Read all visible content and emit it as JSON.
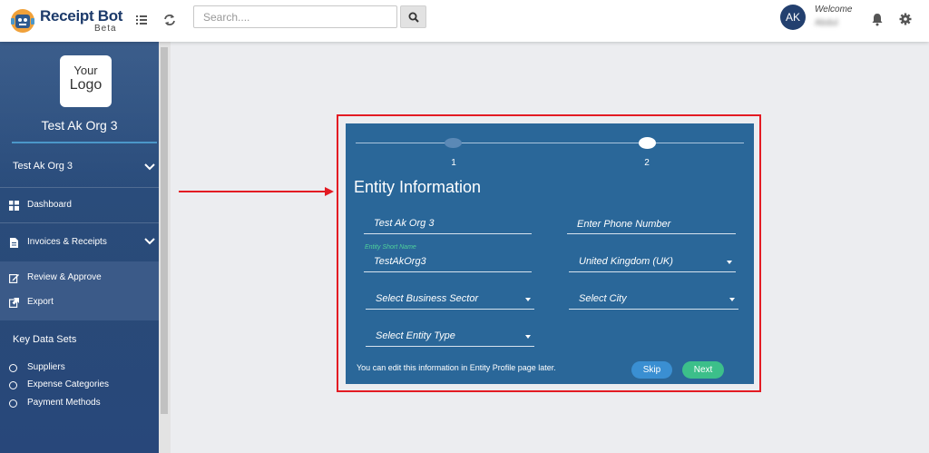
{
  "header": {
    "brand": "Receipt Bot",
    "brand_sub": "Beta",
    "search_placeholder": "Search....",
    "avatar_initials": "AK",
    "welcome_label": "Welcome",
    "user_name": "Abdul"
  },
  "sidebar": {
    "logo_line1": "Your",
    "logo_line2": "Logo",
    "org_title": "Test Ak Org 3",
    "org_selector": "Test Ak Org 3",
    "items": [
      {
        "label": "Dashboard"
      },
      {
        "label": "Invoices & Receipts"
      },
      {
        "label": "Review & Approve"
      },
      {
        "label": "Export"
      }
    ],
    "key_data_sets_label": "Key Data Sets",
    "data_sets": [
      {
        "label": "Suppliers"
      },
      {
        "label": "Expense Categories"
      },
      {
        "label": "Payment Methods"
      }
    ]
  },
  "dialog": {
    "steps": [
      "1",
      "2"
    ],
    "current_step": 1,
    "title": "Entity Information",
    "entity_name": "Test Ak Org 3",
    "phone_placeholder": "Enter Phone Number",
    "short_name_label": "Entity Short Name",
    "short_name": "TestAkOrg3",
    "country": "United Kingdom (UK)",
    "business_sector": "Select Business Sector",
    "city": "Select City",
    "entity_type": "Select Entity Type",
    "note": "You can edit this information in Entity Profile page later.",
    "skip_label": "Skip",
    "next_label": "Next"
  },
  "colors": {
    "sidebar": "#2b4f80",
    "dialog": "#2a6799",
    "highlight": "#e31b23",
    "next_button": "#3cbf8a",
    "skip_button": "#3a8fd2",
    "accent_label": "#4fd09a"
  }
}
